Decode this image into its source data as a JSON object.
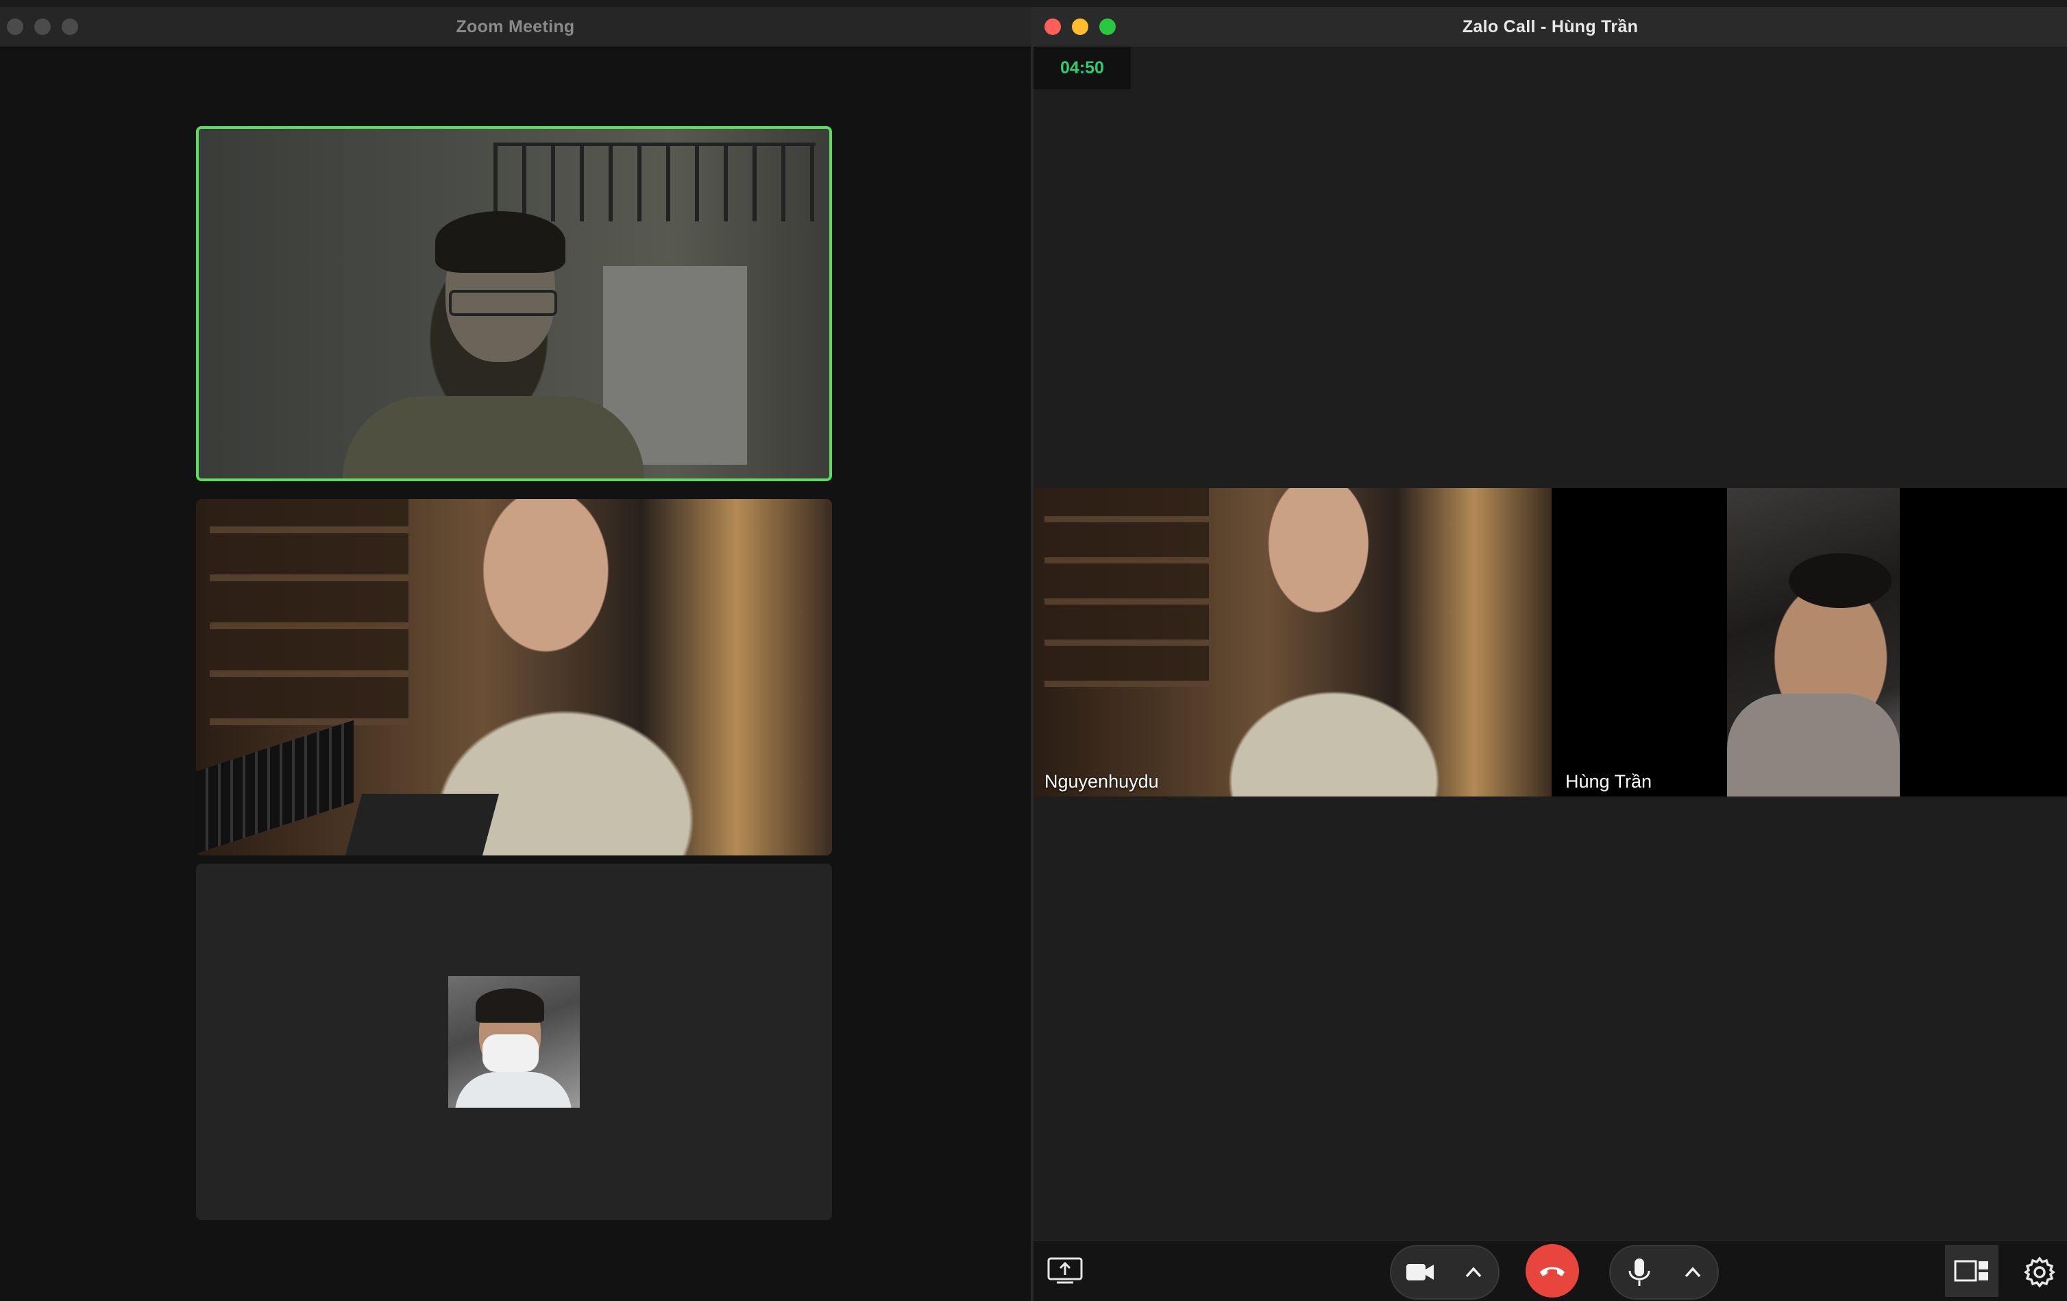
{
  "zoom": {
    "title": "Zoom Meeting",
    "participants": [
      {
        "role": "active-speaker"
      },
      {
        "role": "participant"
      },
      {
        "role": "avatar-only"
      }
    ]
  },
  "zalo": {
    "title": "Zalo Call - Hùng Trần",
    "timer": "04:50",
    "participants": [
      {
        "name": "Nguyenhuydu"
      },
      {
        "name": "Hùng Trần"
      }
    ],
    "controls": {
      "share": "screen-share-icon",
      "camera": "video-camera-icon",
      "hangup": "phone-hangup-icon",
      "mic": "microphone-icon",
      "layout": "layout-icon",
      "settings": "gear-icon"
    },
    "colors": {
      "timer": "#2ecc71",
      "hangup": "#e8453c",
      "active_speaker": "#5ddc5d"
    }
  }
}
